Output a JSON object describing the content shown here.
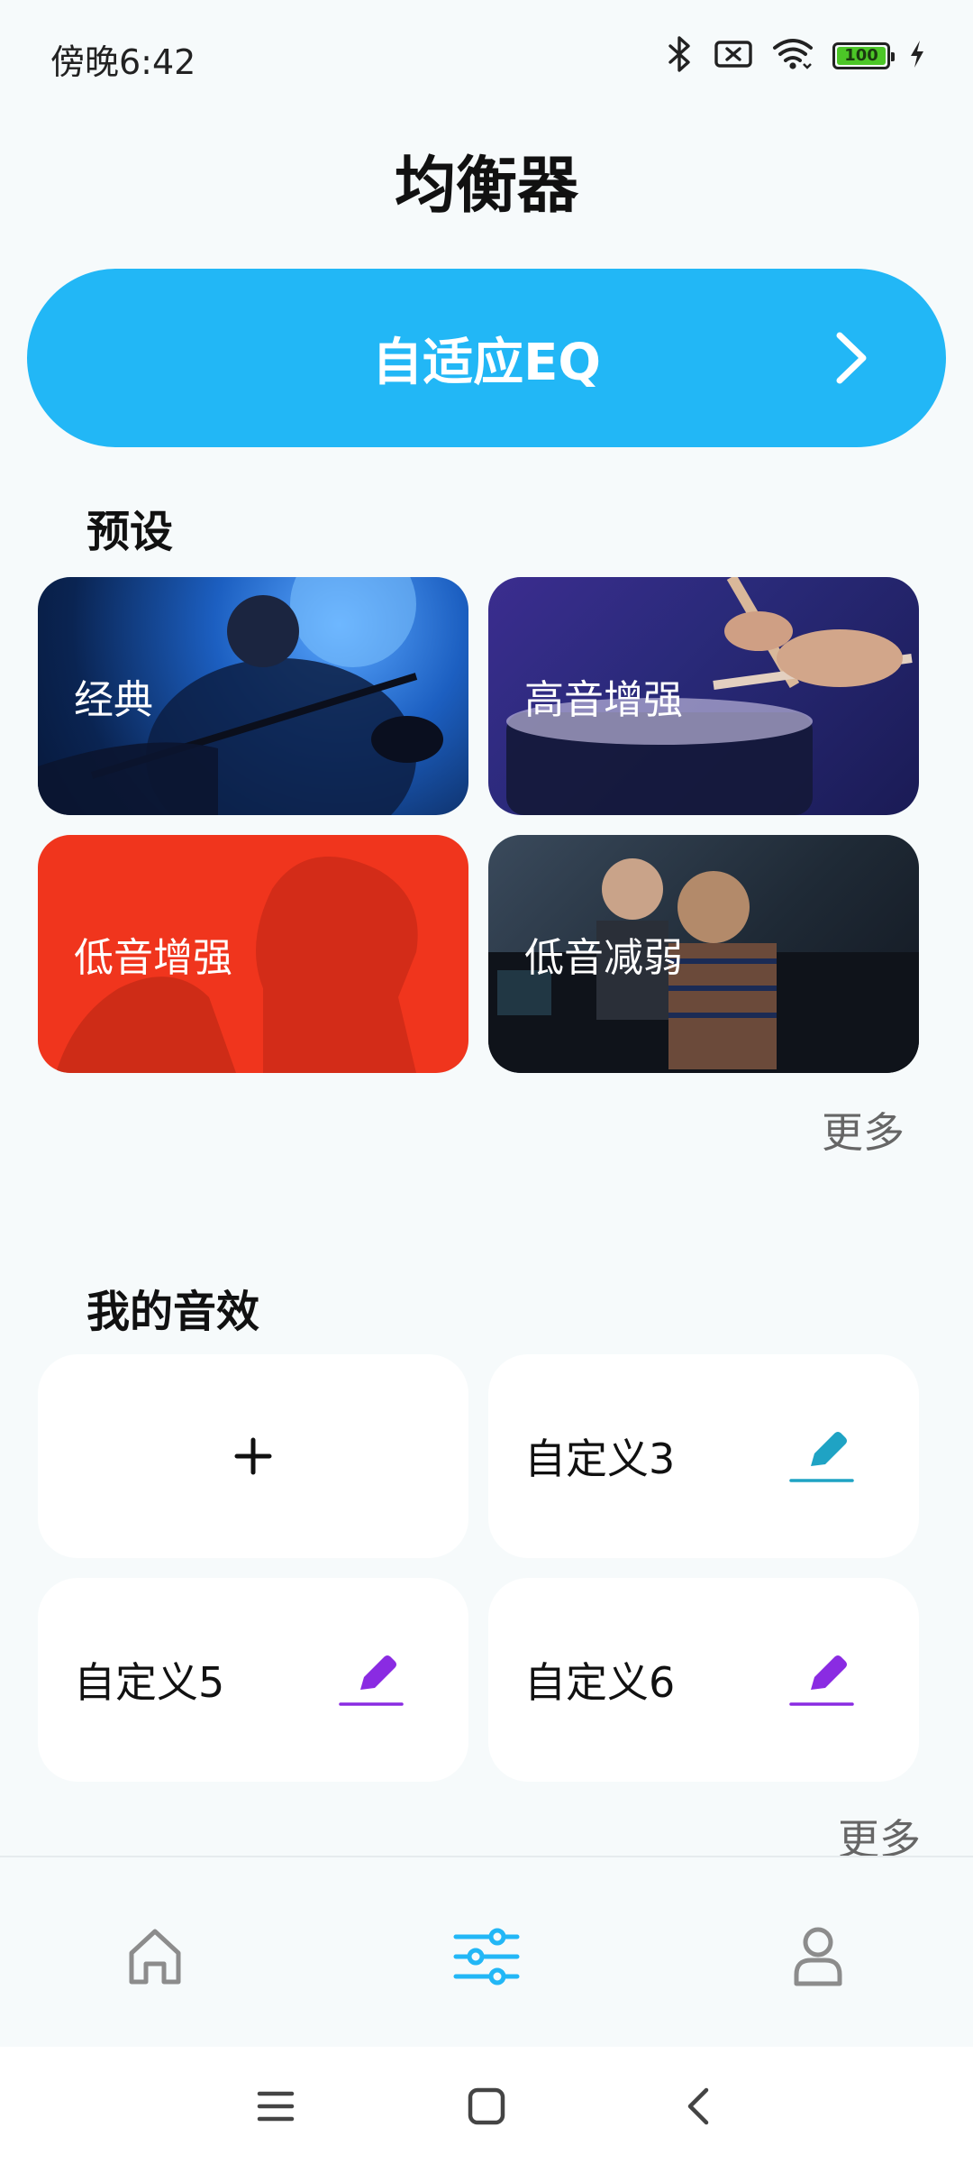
{
  "status_bar": {
    "time": "傍晚6:42",
    "battery_level": "100",
    "icons": [
      "bluetooth-icon",
      "sim-no-signal-icon",
      "wifi-icon",
      "battery-icon",
      "charging-icon"
    ]
  },
  "header": {
    "title": "均衡器"
  },
  "adaptive_eq": {
    "label": "自适应EQ",
    "icon": "chevron-right-icon"
  },
  "presets": {
    "title": "预设",
    "more": "更多",
    "items": [
      {
        "label": "经典"
      },
      {
        "label": "高音增强"
      },
      {
        "label": "低音增强"
      },
      {
        "label": "低音减弱"
      }
    ]
  },
  "my_effects": {
    "title": "我的音效",
    "more": "更多",
    "add_icon": "plus-icon",
    "items": [
      {
        "label": "自定义3",
        "icon_color": "#1fa3c4"
      },
      {
        "label": "自定义5",
        "icon_color": "#8a2be2"
      },
      {
        "label": "自定义6",
        "icon_color": "#8a2be2"
      }
    ]
  },
  "bottom_nav": {
    "items": [
      {
        "icon": "home-icon",
        "active": false
      },
      {
        "icon": "equalizer-icon",
        "active": true
      },
      {
        "icon": "profile-icon",
        "active": false
      }
    ],
    "active_color": "#22b7f6",
    "inactive_color": "#8c8c8c"
  },
  "system_nav": {
    "icons": [
      "menu-icon",
      "home-square-icon",
      "back-icon"
    ]
  },
  "colors": {
    "accent": "#22b7f6",
    "background": "#f6fafb"
  }
}
